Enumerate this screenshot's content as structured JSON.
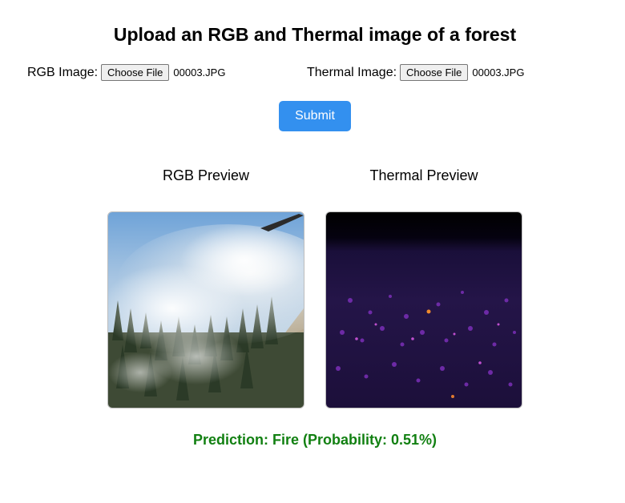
{
  "page": {
    "title": "Upload an RGB and Thermal image of a forest"
  },
  "form": {
    "rgb": {
      "label": "RGB Image:",
      "button_label": "Choose File",
      "file_name": "00003.JPG"
    },
    "thermal": {
      "label": "Thermal Image:",
      "button_label": "Choose File",
      "file_name": "00003.JPG"
    },
    "submit_label": "Submit",
    "submit_color": "#3390ef"
  },
  "previews": {
    "rgb_title": "RGB Preview",
    "thermal_title": "Thermal Preview"
  },
  "result": {
    "prediction": "Prediction: Fire (Probability: 0.51%)",
    "color": "#128012"
  }
}
